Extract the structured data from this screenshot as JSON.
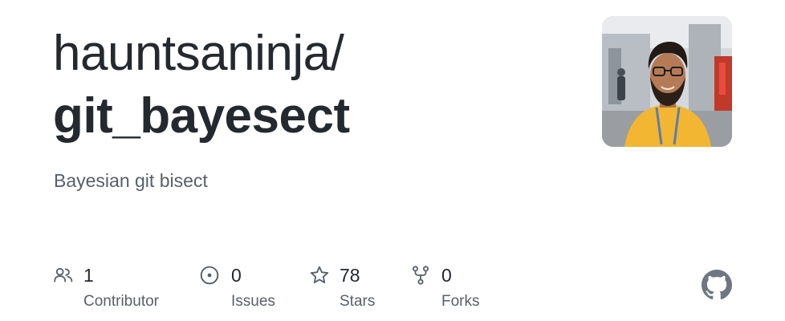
{
  "repo_card": {
    "owner": "hauntsaninja/",
    "name": "git_bayesect",
    "description": "Bayesian git bisect"
  },
  "avatar": {
    "icon": "user-avatar"
  },
  "stats": {
    "contributors": {
      "value": "1",
      "label": "Contributor",
      "icon": "people-icon"
    },
    "issues": {
      "value": "0",
      "label": "Issues",
      "icon": "issue-opened-icon"
    },
    "stars": {
      "value": "78",
      "label": "Stars",
      "icon": "star-icon"
    },
    "forks": {
      "value": "0",
      "label": "Forks",
      "icon": "repo-forked-icon"
    }
  },
  "branding": {
    "icon": "github-logo-icon"
  },
  "colors": {
    "title": "#24292f",
    "muted": "#57606a",
    "logo": "#6e7781"
  }
}
